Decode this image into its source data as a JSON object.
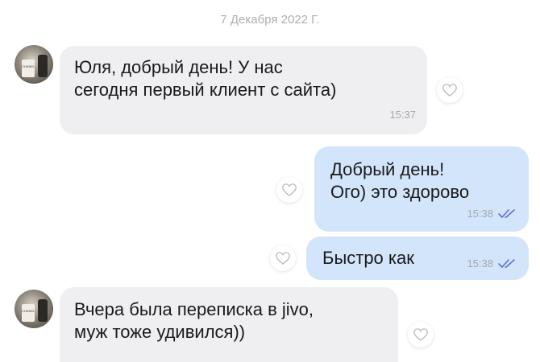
{
  "chat": {
    "date_separator": "7 Декабря 2022 Г.",
    "avatar_text": "CHANEL",
    "messages": [
      {
        "direction": "incoming",
        "text": "Юля, добрый день! У нас\nсегодня первый клиент с сайта)",
        "time": "15:37"
      },
      {
        "direction": "outgoing",
        "text": "Добрый день!\nОго) это здорово",
        "time": "15:38",
        "status_icon": "double-check-icon"
      },
      {
        "direction": "outgoing",
        "text": "Быстро как",
        "time": "15:38",
        "status_icon": "double-check-icon"
      },
      {
        "direction": "incoming",
        "text": "Вчера была переписка в jivo,\nмуж тоже удивился))",
        "time": ""
      }
    ]
  },
  "colors": {
    "incoming_bubble": "#efeff1",
    "outgoing_bubble": "#d3e5fb",
    "time_text": "#a5a8ae",
    "check_icon": "#5b6fd6"
  }
}
